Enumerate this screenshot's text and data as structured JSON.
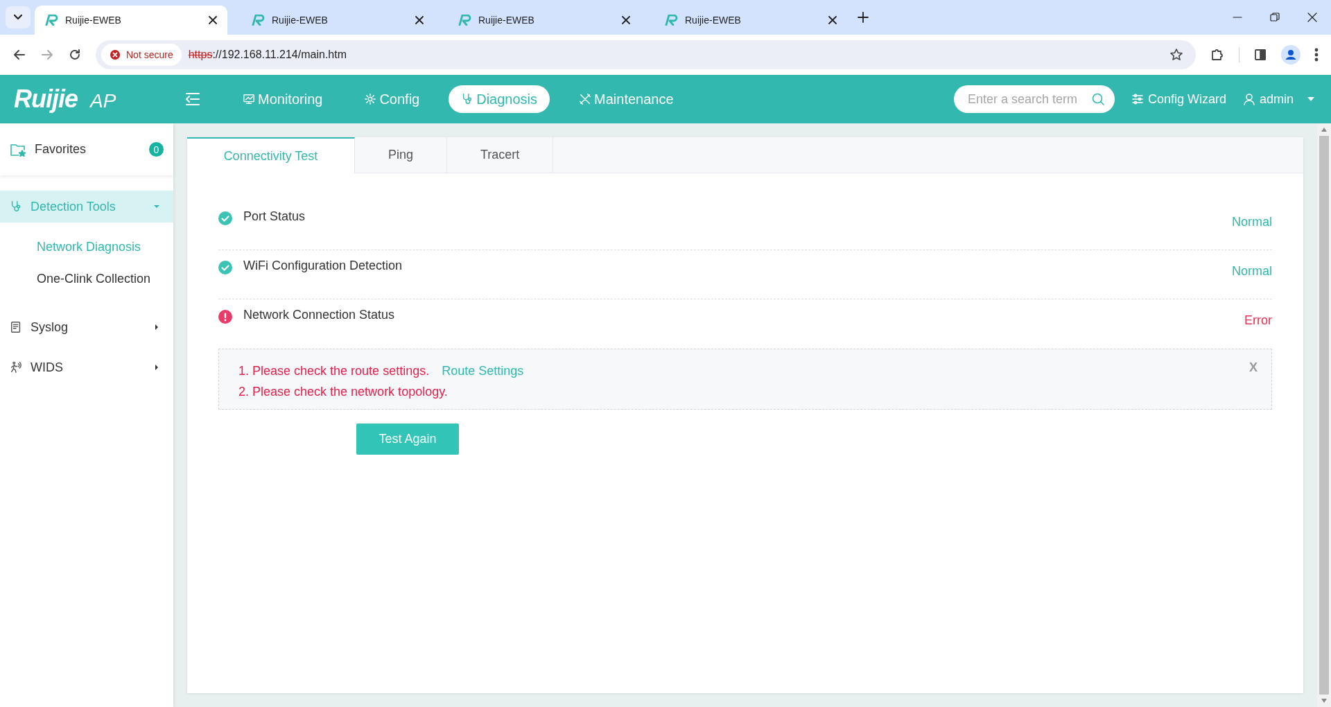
{
  "browser": {
    "tabs": [
      {
        "title": "Ruijie-EWEB",
        "selected": true
      },
      {
        "title": "Ruijie-EWEB",
        "selected": false
      },
      {
        "title": "Ruijie-EWEB",
        "selected": false
      },
      {
        "title": "Ruijie-EWEB",
        "selected": false
      }
    ],
    "security": "Not secure",
    "url_scheme": "https",
    "url_rest": "://192.168.11.214/main.htm"
  },
  "header": {
    "logo": "Ruijie",
    "product": "AP",
    "nav": [
      {
        "label": "Monitoring",
        "selected": false
      },
      {
        "label": "Config",
        "selected": false
      },
      {
        "label": "Diagnosis",
        "selected": true
      },
      {
        "label": "Maintenance",
        "selected": false
      }
    ],
    "search": {
      "placeholder": "Enter a search term"
    },
    "wizard": "Config Wizard",
    "user": "admin"
  },
  "sidebar": {
    "favorites": {
      "label": "Favorites",
      "count": "0"
    },
    "items": [
      {
        "label": "Detection Tools",
        "expanded": true,
        "selected": true,
        "children": [
          {
            "label": "Network Diagnosis",
            "selected": true
          },
          {
            "label": "One-Clink Collection",
            "selected": false
          }
        ]
      },
      {
        "label": "Syslog",
        "expanded": false,
        "selected": false
      },
      {
        "label": "WIDS",
        "expanded": false,
        "selected": false
      }
    ]
  },
  "tabs": [
    {
      "label": "Connectivity Test",
      "selected": true
    },
    {
      "label": "Ping",
      "selected": false
    },
    {
      "label": "Tracert",
      "selected": false
    }
  ],
  "checks": [
    {
      "name": "Port Status",
      "ok": true,
      "result": "Normal"
    },
    {
      "name": "WiFi Configuration Detection",
      "ok": true,
      "result": "Normal"
    },
    {
      "name": "Network Connection Status",
      "ok": false,
      "result": "Error"
    }
  ],
  "notice": {
    "lines": [
      {
        "text": "1. Please check the route settings.",
        "link": "Route Settings"
      },
      {
        "text": "2. Please check the network topology."
      }
    ],
    "close": "X"
  },
  "button": "Test Again"
}
